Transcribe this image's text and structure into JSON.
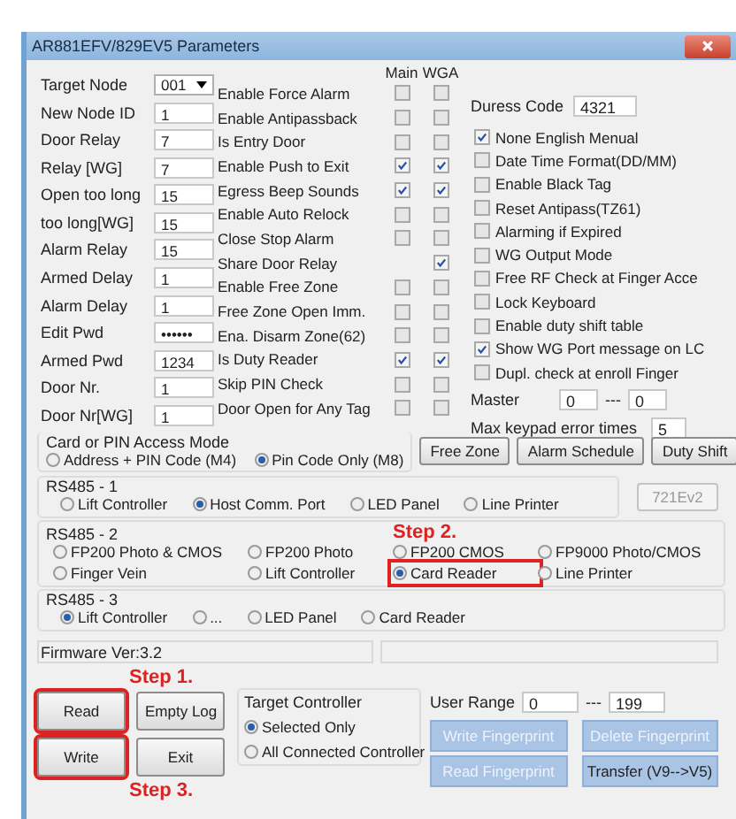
{
  "window": {
    "title": "AR881EFV/829EV5 Parameters"
  },
  "fields": [
    {
      "label": "Target Node",
      "value": "001",
      "kind": "dropdown"
    },
    {
      "label": "New Node ID",
      "value": "1",
      "kind": "text"
    },
    {
      "label": "Door Relay",
      "value": "7",
      "kind": "text"
    },
    {
      "label": "Relay [WG]",
      "value": "7",
      "kind": "text"
    },
    {
      "label": "Open too long",
      "value": "15",
      "kind": "text"
    },
    {
      "label": "too long[WG]",
      "value": "15",
      "kind": "text"
    },
    {
      "label": "Alarm Relay",
      "value": "15",
      "kind": "text"
    },
    {
      "label": "Armed Delay",
      "value": "1",
      "kind": "text"
    },
    {
      "label": "Alarm Delay",
      "value": "1",
      "kind": "text"
    },
    {
      "label": "Edit Pwd",
      "value": "••••••",
      "kind": "text"
    },
    {
      "label": "Armed Pwd",
      "value": "1234",
      "kind": "text"
    },
    {
      "label": "Door Nr.",
      "value": "1",
      "kind": "text"
    },
    {
      "label": "Door Nr[WG]",
      "value": "1",
      "kind": "text"
    }
  ],
  "flag_columns": [
    "Main",
    "WGA"
  ],
  "flags": [
    {
      "label": "Enable Force Alarm",
      "main": false,
      "wga": false
    },
    {
      "label": "Enable Antipassback",
      "main": false,
      "wga": false
    },
    {
      "label": "Is Entry Door",
      "main": false,
      "wga": false
    },
    {
      "label": "Enable Push to Exit",
      "main": true,
      "wga": true
    },
    {
      "label": "Egress Beep Sounds",
      "main": true,
      "wga": true
    },
    {
      "label": "Enable Auto Relock",
      "main": false,
      "wga": false
    },
    {
      "label": "Close Stop Alarm",
      "main": false,
      "wga": false
    },
    {
      "label": "Share Door Relay",
      "wga": true
    },
    {
      "label": "Enable Free Zone",
      "main": false,
      "wga": false
    },
    {
      "label": "Free Zone Open Imm.",
      "main": false,
      "wga": false
    },
    {
      "label": "Ena. Disarm Zone(62)",
      "main": false,
      "wga": false
    },
    {
      "label": "Is Duty Reader",
      "main": true,
      "wga": true
    },
    {
      "label": "Skip PIN Check",
      "main": false,
      "wga": false
    },
    {
      "label": "Door Open for Any Tag",
      "main": false,
      "wga": false
    }
  ],
  "duress": {
    "label": "Duress Code",
    "value": "4321"
  },
  "options": [
    {
      "label": "None English Menual",
      "checked": true
    },
    {
      "label": "Date Time Format(DD/MM)",
      "checked": false
    },
    {
      "label": "Enable Black Tag",
      "checked": false
    },
    {
      "label": "Reset Antipass(TZ61)",
      "checked": false
    },
    {
      "label": "Alarming if Expired",
      "checked": false
    },
    {
      "label": "WG Output Mode",
      "checked": false
    },
    {
      "label": "Free RF Check at Finger Acce",
      "checked": false
    },
    {
      "label": "Lock Keyboard",
      "checked": false
    },
    {
      "label": "Enable duty shift table",
      "checked": false
    },
    {
      "label": "Show WG Port message on LC",
      "checked": true
    },
    {
      "label": "Dupl. check at enroll  Finger",
      "checked": false
    }
  ],
  "master": {
    "label": "Master",
    "from": "0",
    "separator": "---",
    "to": "0"
  },
  "max_keypad": {
    "label": "Max keypad error times",
    "value": "5"
  },
  "access_mode": {
    "title": "Card or PIN Access Mode",
    "options": [
      {
        "label": "Address + PIN Code (M4)",
        "selected": false
      },
      {
        "label": "Pin Code Only (M8)",
        "selected": true
      }
    ]
  },
  "side_buttons": [
    "Free Zone",
    "Alarm Schedule",
    "Duty Shift"
  ],
  "rs485": [
    {
      "title": "RS485 - 1",
      "options": [
        {
          "label": "Lift Controller",
          "selected": false
        },
        {
          "label": "Host Comm. Port",
          "selected": true
        },
        {
          "label": "LED Panel",
          "selected": false
        },
        {
          "label": "Line Printer",
          "selected": false
        }
      ],
      "button": {
        "label": "721Ev2",
        "disabled": true
      }
    },
    {
      "title": "RS485 - 2",
      "annotation": "Step 2.",
      "options": [
        {
          "label": "FP200 Photo & CMOS",
          "selected": false
        },
        {
          "label": "FP200 Photo",
          "selected": false
        },
        {
          "label": "FP200 CMOS",
          "selected": false
        },
        {
          "label": "FP9000 Photo/CMOS",
          "selected": false
        },
        {
          "label": "Finger Vein",
          "selected": false
        },
        {
          "label": "Lift Controller",
          "selected": false
        },
        {
          "label": "Card Reader",
          "selected": true,
          "highlighted": true
        },
        {
          "label": "Line Printer",
          "selected": false
        }
      ]
    },
    {
      "title": "RS485 - 3",
      "options": [
        {
          "label": "Lift Controller",
          "selected": true
        },
        {
          "label": "...",
          "selected": false
        },
        {
          "label": "LED Panel",
          "selected": false
        },
        {
          "label": "Card Reader",
          "selected": false
        }
      ]
    }
  ],
  "firmware": {
    "text": "Firmware Ver:3.2"
  },
  "main_buttons": [
    {
      "label": "Read",
      "highlighted": true,
      "annotation": "Step 1."
    },
    {
      "label": "Empty Log",
      "highlighted": false
    },
    {
      "label": "Write",
      "highlighted": true,
      "annotation": "Step 3."
    },
    {
      "label": "Exit",
      "highlighted": false
    }
  ],
  "target_controller": {
    "title": "Target Controller",
    "options": [
      {
        "label": "Selected Only",
        "selected": true
      },
      {
        "label": "All Connected Controller",
        "selected": false
      }
    ]
  },
  "user_range": {
    "label": "User Range",
    "from": "0",
    "separator": "---",
    "to": "199"
  },
  "fingerprint_buttons": [
    {
      "label": "Write Fingerprint",
      "disabled": true
    },
    {
      "label": "Delete Fingerprint",
      "disabled": true
    },
    {
      "label": "Read Fingerprint",
      "disabled": true
    },
    {
      "label": "Transfer (V9-->V5)",
      "disabled": false
    }
  ]
}
